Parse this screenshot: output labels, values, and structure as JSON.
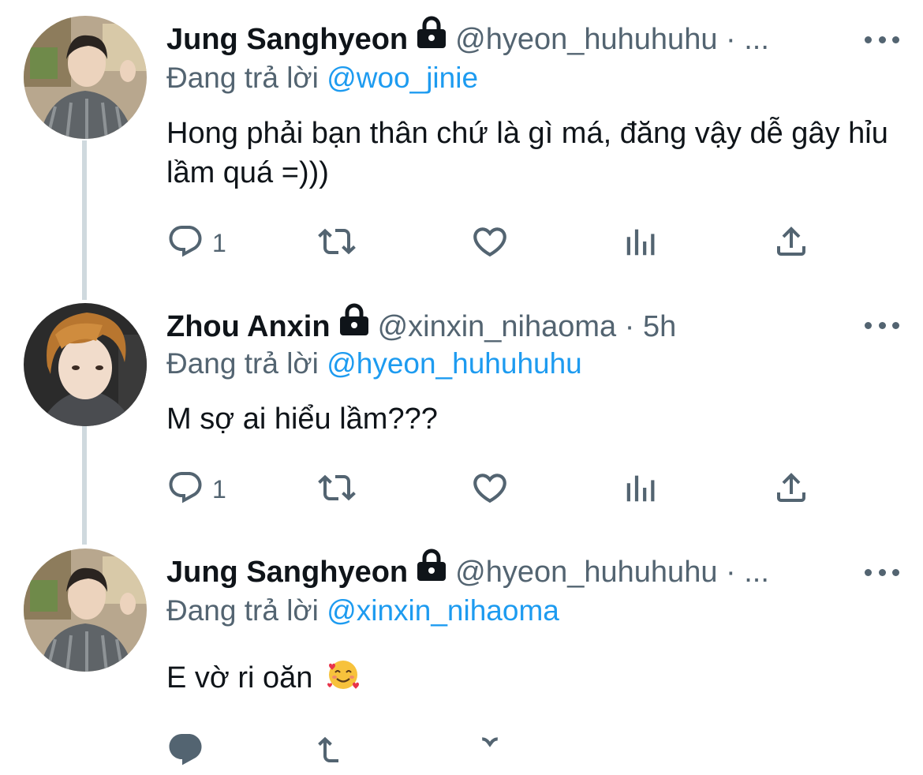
{
  "colors": {
    "accent": "#1d9bf0",
    "text_primary": "#0f1419",
    "text_secondary": "#536471",
    "thread_line": "#cfd9de"
  },
  "tweets": [
    {
      "author": "Jung Sanghyeon",
      "handle_time": "@hyeon_huhuhuhu · ...",
      "replying_prefix": "Đang trả lời",
      "replying_to": "@woo_jinie",
      "text": "Hong phải bạn thân chứ là gì má, đăng vậy dễ gây hỉu lầm quá =)))",
      "reply_count": "1",
      "locked": true,
      "avatar_icon": "avatar-photo"
    },
    {
      "author": "Zhou Anxin",
      "handle_time": "@xinxin_nihaoma · 5h",
      "replying_prefix": "Đang trả lời",
      "replying_to": "@hyeon_huhuhuhu",
      "text": "M sợ ai hiểu lầm???",
      "reply_count": "1",
      "locked": true,
      "avatar_icon": "avatar-photo"
    },
    {
      "author": "Jung Sanghyeon",
      "handle_time": "@hyeon_huhuhuhu · ...",
      "replying_prefix": "Đang trả lời",
      "replying_to": "@xinxin_nihaoma",
      "text": "E vờ ri oăn",
      "emoji": "smiling-face-with-hearts",
      "locked": true,
      "avatar_icon": "avatar-photo"
    }
  ],
  "action_icons": [
    "reply-icon",
    "retweet-icon",
    "like-icon",
    "analytics-icon",
    "share-icon"
  ]
}
